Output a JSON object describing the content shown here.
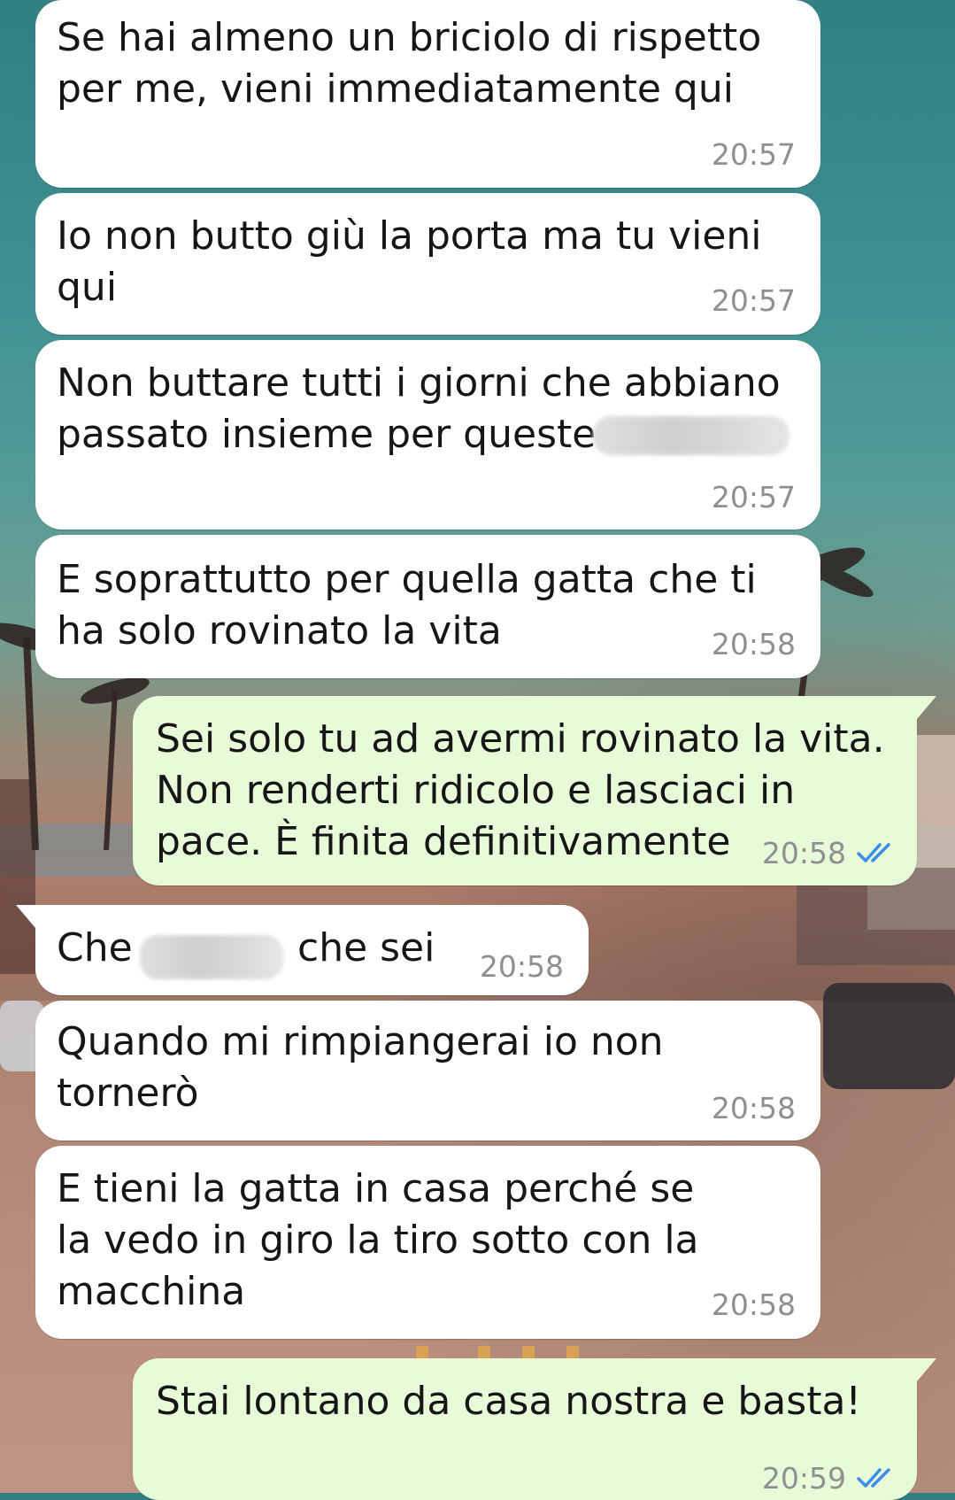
{
  "conversation": {
    "messages": [
      {
        "text": "Se hai almeno un briciolo di rispetto\nper me, vieni immediatamente qui",
        "time": "20:57"
      },
      {
        "text": "Io non butto giù la porta ma tu vieni\nqui",
        "time": "20:57"
      },
      {
        "text": "Non buttare tutti i giorni che abbiano\npassato insieme per queste",
        "time": "20:57"
      },
      {
        "text": "E soprattutto per quella gatta che ti\nha solo rovinato la vita",
        "time": "20:58"
      },
      {
        "text": "Sei solo tu ad avermi rovinato la vita.\nNon renderti ridicolo e lasciaci in\npace. È finita definitivamente",
        "time": "20:58"
      },
      {
        "text_before": "Che",
        "text_after": "che sei",
        "time": "20:58"
      },
      {
        "text": "Quando mi rimpiangerai io non\ntornerò",
        "time": "20:58"
      },
      {
        "text": "E tieni la gatta in casa perché se\nla vedo in giro la tiro sotto con la\nmacchina",
        "time": "20:58"
      },
      {
        "text": "Stai lontano da casa nostra e basta!",
        "time": "20:59"
      }
    ]
  },
  "colors": {
    "incoming_bubble": "#ffffff",
    "outgoing_bubble": "#e7fbd9",
    "read_ticks": "#3a8ee6",
    "timestamp": "#8f8f8f"
  },
  "icons": {
    "read_receipt": "double-check-icon"
  }
}
